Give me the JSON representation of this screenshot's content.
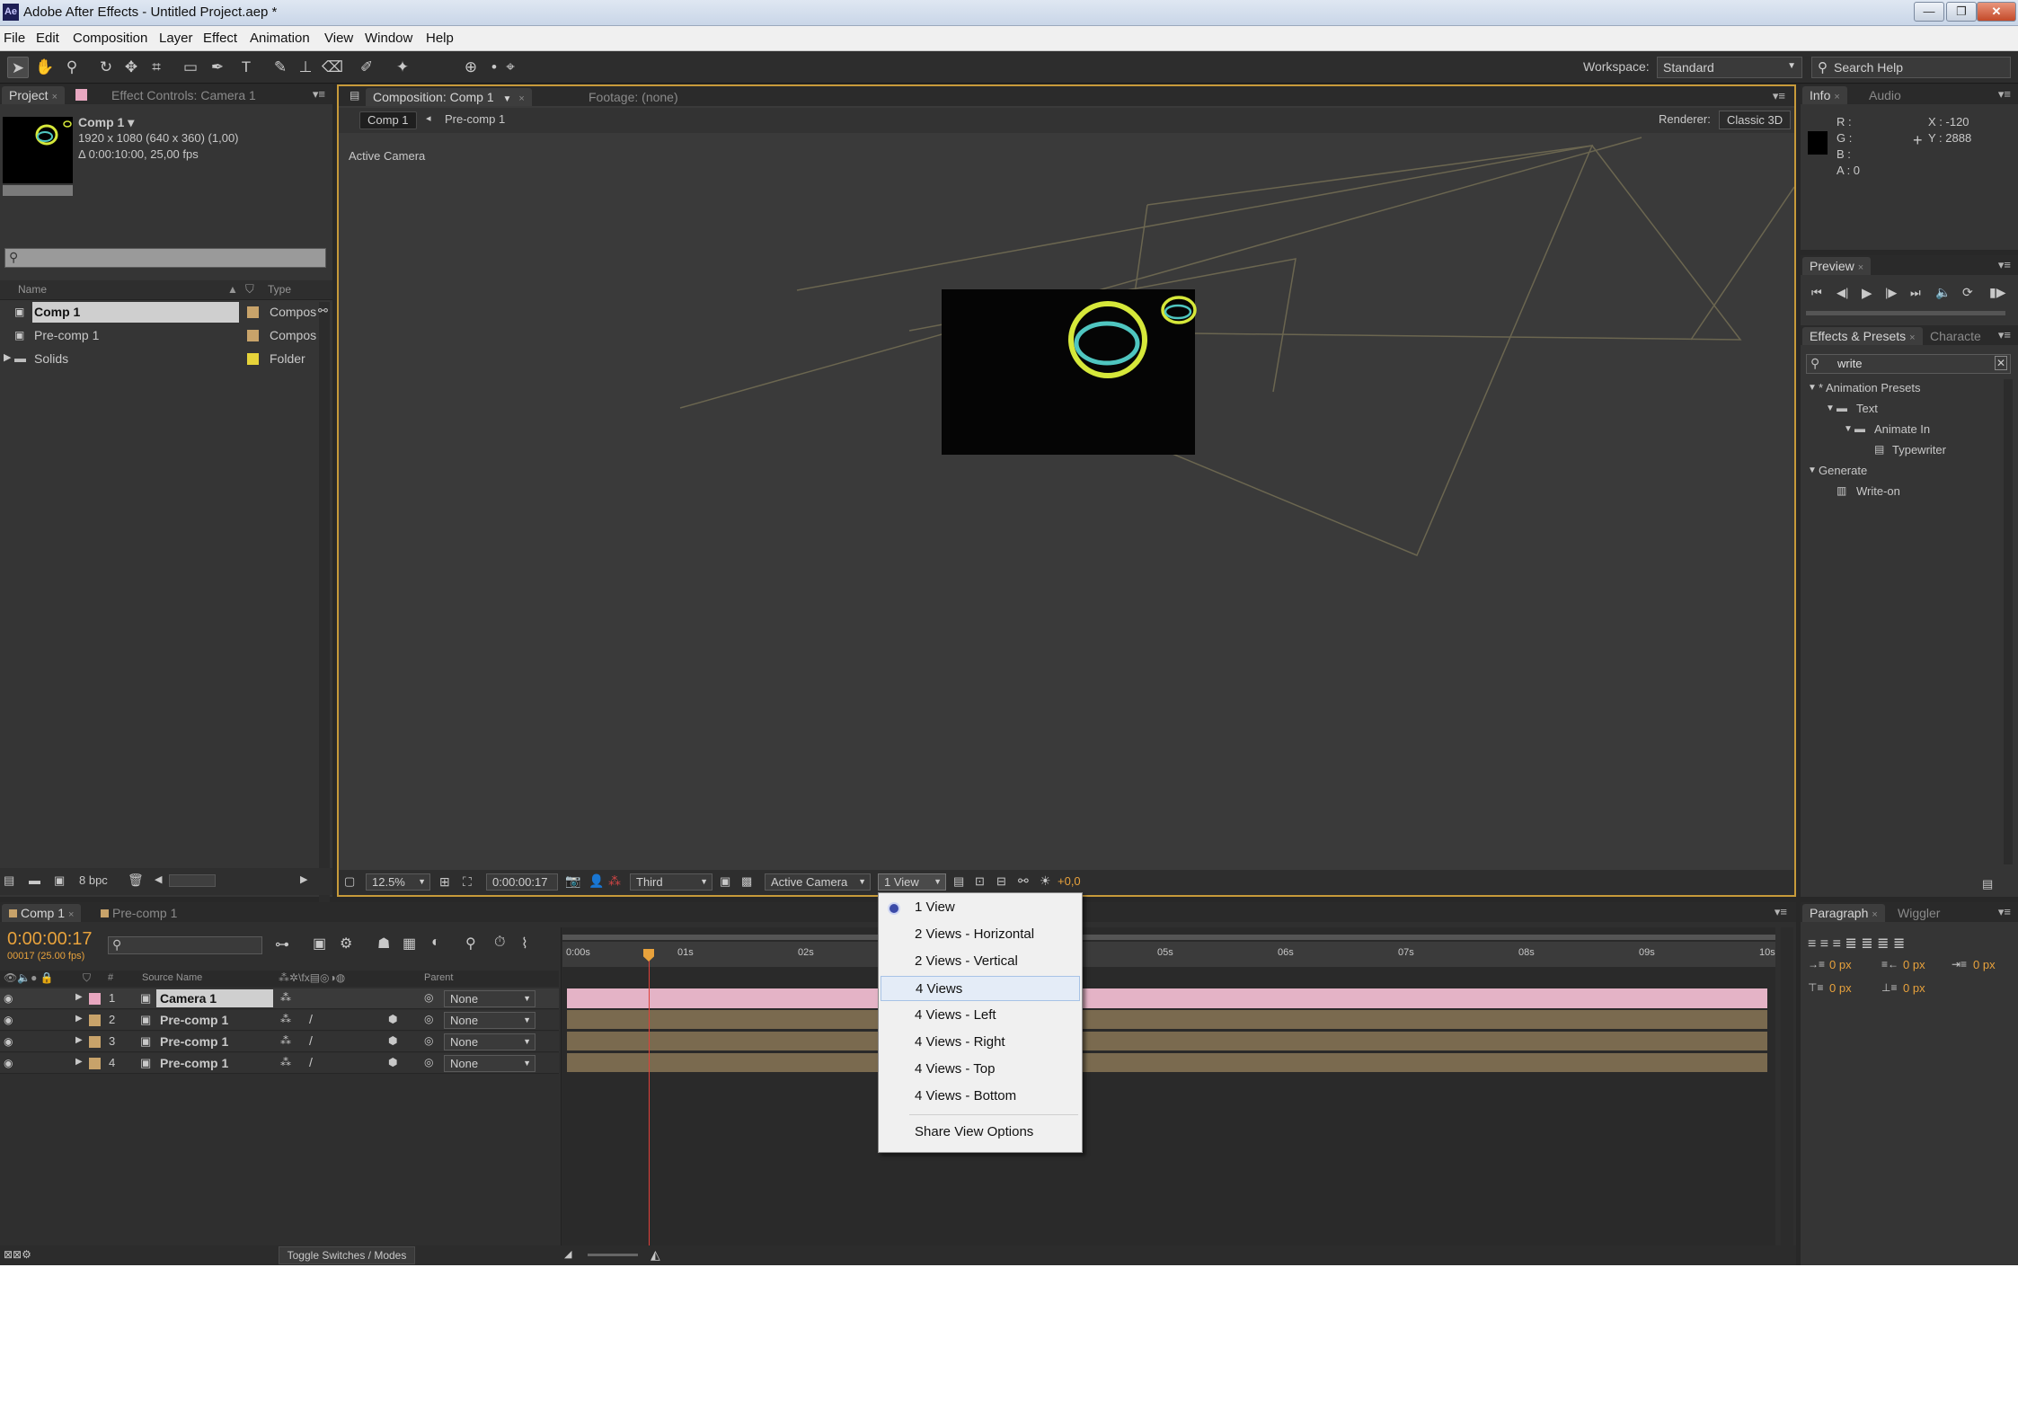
{
  "window": {
    "app_logo": "Ae",
    "title": "Adobe After Effects - Untitled Project.aep *",
    "minimize": "—",
    "restore": "❐",
    "close": "✕"
  },
  "menu": [
    "File",
    "Edit",
    "Composition",
    "Layer",
    "Effect",
    "Animation",
    "View",
    "Window",
    "Help"
  ],
  "toolbar": {
    "workspace_label": "Workspace:",
    "workspace_value": "Standard",
    "search_placeholder": "Search Help"
  },
  "project_panel": {
    "tabs": [
      "Project",
      "Effect Controls: Camera 1"
    ],
    "comp_name": "Comp 1 ▾",
    "comp_size": "1920 x 1080  (640 x 360) (1,00)",
    "comp_duration": "Δ 0:00:10:00, 25,00 fps",
    "columns": [
      "Name",
      "Type"
    ],
    "items": [
      {
        "name": "Comp 1",
        "type": "Compos",
        "selected": true
      },
      {
        "name": "Pre-comp 1",
        "type": "Compos",
        "selected": false
      },
      {
        "name": "Solids",
        "type": "Folder",
        "selected": false
      }
    ],
    "bit_depth": "8 bpc"
  },
  "composition_panel": {
    "tabs": [
      "Composition: Comp 1",
      "Footage: (none)"
    ],
    "breadcrumbs": [
      "Comp 1",
      "Pre-comp 1"
    ],
    "renderer_label": "Renderer:",
    "renderer_value": "Classic 3D",
    "view_label": "Active Camera",
    "zoom": "12.5%",
    "timecode": "0:00:00:17",
    "resolution": "Third",
    "camera": "Active Camera",
    "views": "1 View",
    "exposure": "+0,0"
  },
  "info_panel": {
    "tabs": [
      "Info",
      "Audio"
    ],
    "r": "R :",
    "g": "G :",
    "b": "B :",
    "a": "A : 0",
    "x": "X : -120",
    "y": "Y : 2888"
  },
  "preview_panel": {
    "tabs": [
      "Preview"
    ]
  },
  "effects_panel": {
    "tabs": [
      "Effects & Presets",
      "Characte"
    ],
    "search_value": "write",
    "tree": [
      "* Animation Presets",
      "Text",
      "Animate In",
      "Typewriter",
      "Generate",
      "Write-on"
    ]
  },
  "paragraph_panel": {
    "tabs": [
      "Paragraph",
      "Wiggler"
    ],
    "values": [
      "0 px",
      "0 px",
      "0 px",
      "0 px",
      "0 px"
    ]
  },
  "timeline": {
    "tabs": [
      "Comp 1",
      "Pre-comp 1"
    ],
    "timecode": "0:00:00:17",
    "frame_info": "00017 (25.00 fps)",
    "columns": {
      "num": "#",
      "source_name": "Source Name",
      "parent": "Parent"
    },
    "ruler_labels": [
      "0:00s",
      "01s",
      "02s",
      "05s",
      "06s",
      "07s",
      "08s",
      "09s",
      "10s"
    ],
    "layers": [
      {
        "num": "1",
        "name": "Camera 1",
        "parent": "None",
        "color": "#e8a7c0"
      },
      {
        "num": "2",
        "name": "Pre-comp 1",
        "parent": "None",
        "color": "#c8a36a"
      },
      {
        "num": "3",
        "name": "Pre-comp 1",
        "parent": "None",
        "color": "#c8a36a"
      },
      {
        "num": "4",
        "name": "Pre-comp 1",
        "parent": "None",
        "color": "#c8a36a"
      }
    ],
    "toggle_label": "Toggle Switches / Modes"
  },
  "view_menu": {
    "items": [
      "1 View",
      "2 Views - Horizontal",
      "2 Views - Vertical",
      "4 Views",
      "4 Views - Left",
      "4 Views - Right",
      "4 Views - Top",
      "4 Views - Bottom"
    ],
    "share_option": "Share View Options",
    "checked_index": 0,
    "hover_index": 3
  },
  "colors": {
    "accent_orange": "#e8a23c",
    "camera_bar": "#e4b3c6",
    "precomp_bar": "#7a6a4f",
    "circle_yellow": "#d6e83a",
    "circle_cyan": "#4fc6c0"
  }
}
